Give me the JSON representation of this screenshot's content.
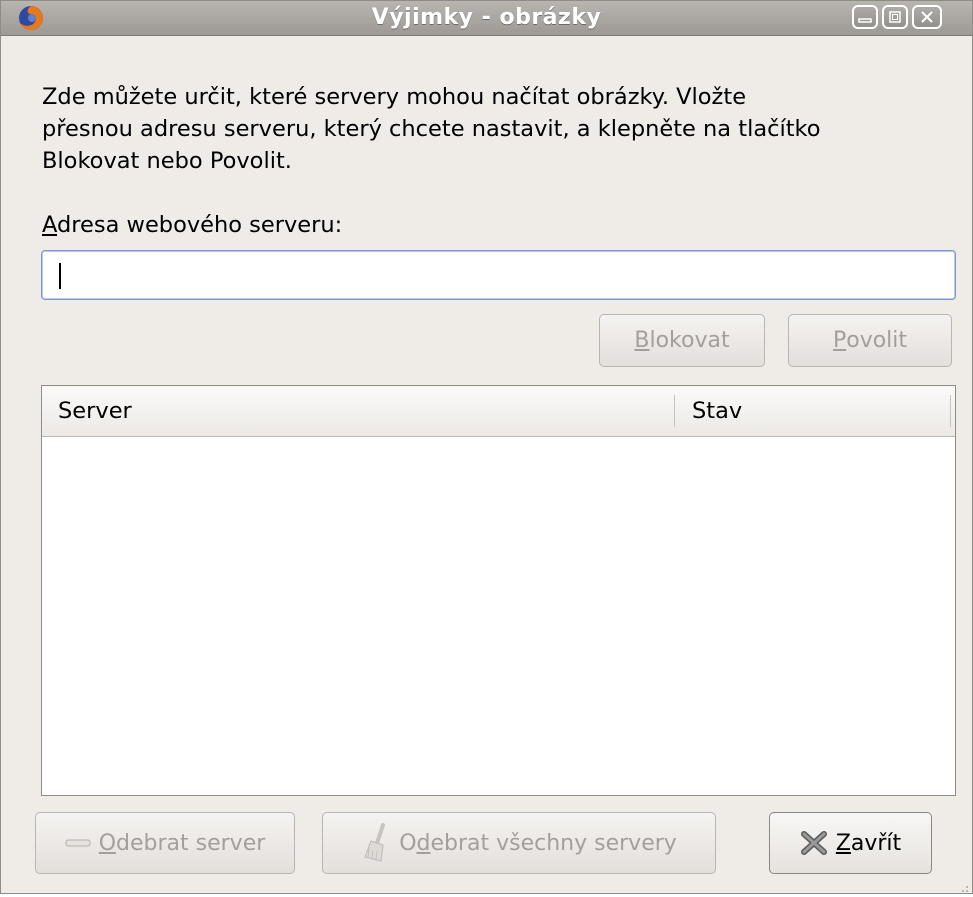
{
  "window": {
    "title": "Výjimky - obrázky",
    "app_icon": "firefox-icon",
    "controls": [
      "minimize-icon",
      "maximize-icon",
      "close-icon"
    ]
  },
  "description": {
    "line1": "Zde můžete určit, které servery mohou načítat obrázky. Vložte",
    "line2": "přesnou adresu serveru, který chcete nastavit, a klepněte na tlačítko",
    "line3": "Blokovat nebo Povolit."
  },
  "address": {
    "label_mnemonic": "A",
    "label_rest": "dresa webového serveru:",
    "value": "",
    "placeholder": ""
  },
  "actions": {
    "block": {
      "mnemonic": "B",
      "rest": "lokovat"
    },
    "allow": {
      "mnemonic": "P",
      "rest": "ovolit"
    }
  },
  "table": {
    "columns": [
      "Server",
      "Stav"
    ],
    "rows": []
  },
  "footer": {
    "remove": {
      "mnemonic": "O",
      "rest": "debrat server",
      "icon": "minus-icon"
    },
    "remove_all": {
      "pre": "O",
      "mnemonic": "d",
      "rest": "ebrat všechny servery",
      "icon": "broom-icon"
    },
    "close": {
      "mnemonic": "Z",
      "rest": "avřít",
      "icon": "x-icon"
    }
  },
  "colors": {
    "window_bg": "#efebe7",
    "titlebar": "#a9a5a0",
    "input_focus": "#7c99c4",
    "disabled_text": "#a39f9a"
  }
}
